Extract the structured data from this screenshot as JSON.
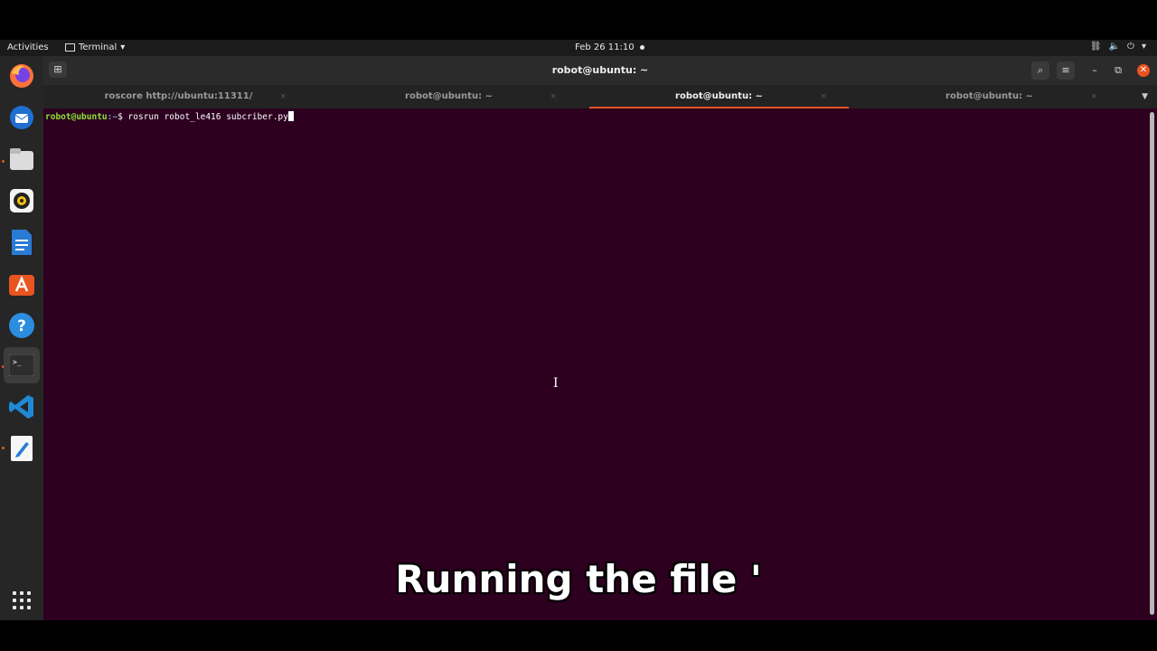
{
  "topbar": {
    "activities": "Activities",
    "app_menu": "Terminal",
    "clock": "Feb 26  11:10"
  },
  "window": {
    "title": "robot@ubuntu: ~"
  },
  "tabs": [
    {
      "label": "roscore http://ubuntu:11311/"
    },
    {
      "label": "robot@ubuntu: ~"
    },
    {
      "label": "robot@ubuntu: ~"
    },
    {
      "label": "robot@ubuntu: ~"
    }
  ],
  "terminal": {
    "prompt_user": "robot@ubuntu",
    "prompt_path": ":~",
    "prompt_symbol": "$ ",
    "command": "rosrun robot_le416 subcriber.py"
  },
  "subtitle": "Running the file '",
  "colors": {
    "terminal_bg": "#2c001e",
    "accent": "#e95420",
    "prompt_user": "#8ae234",
    "prompt_path": "#729fcf"
  }
}
